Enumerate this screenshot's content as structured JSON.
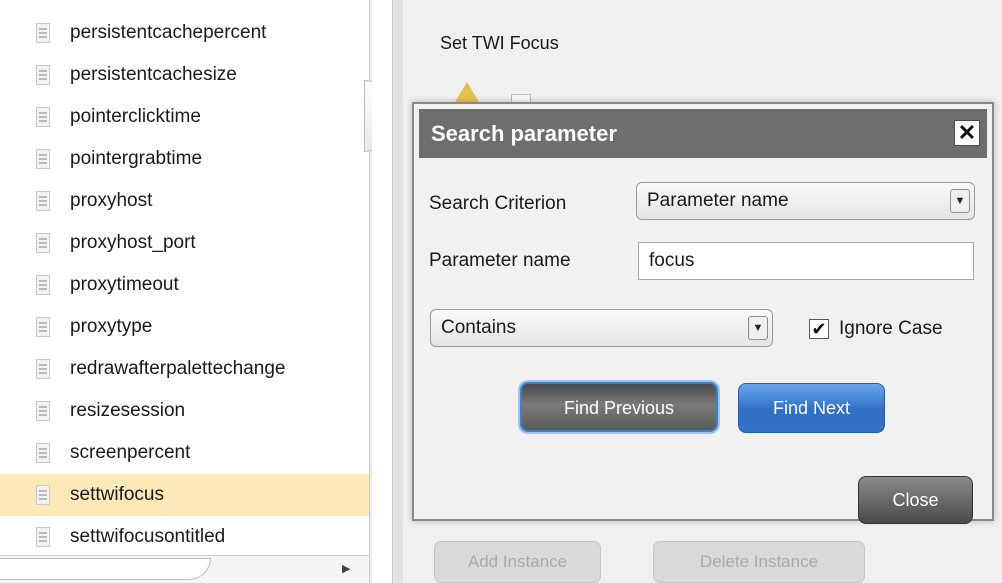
{
  "tree": {
    "items": [
      {
        "label": "persistentcachepercent",
        "selected": false
      },
      {
        "label": "persistentcachesize",
        "selected": false
      },
      {
        "label": "pointerclicktime",
        "selected": false
      },
      {
        "label": "pointergrabtime",
        "selected": false
      },
      {
        "label": "proxyhost",
        "selected": false
      },
      {
        "label": "proxyhost_port",
        "selected": false
      },
      {
        "label": "proxytimeout",
        "selected": false
      },
      {
        "label": "proxytype",
        "selected": false
      },
      {
        "label": "redrawafterpalettechange",
        "selected": false
      },
      {
        "label": "resizesession",
        "selected": false
      },
      {
        "label": "screenpercent",
        "selected": false
      },
      {
        "label": "settwifocus",
        "selected": true
      },
      {
        "label": "settwifocusontitled",
        "selected": false
      }
    ],
    "item_icon": "document-icon",
    "selected_color": "#fde9b7"
  },
  "background_panel": {
    "heading": "Set TWI Focus",
    "add_instance_label": "Add Instance",
    "delete_instance_label": "Delete Instance"
  },
  "dialog": {
    "title": "Search parameter",
    "close_glyph": "✕",
    "criterion_label": "Search Criterion",
    "criterion_value": "Parameter name",
    "param_label": "Parameter name",
    "param_value": "focus",
    "match_mode_value": "Contains",
    "ignore_case_label": "Ignore Case",
    "ignore_case_checked": true,
    "find_previous_label": "Find Previous",
    "find_next_label": "Find Next",
    "close_label": "Close"
  }
}
